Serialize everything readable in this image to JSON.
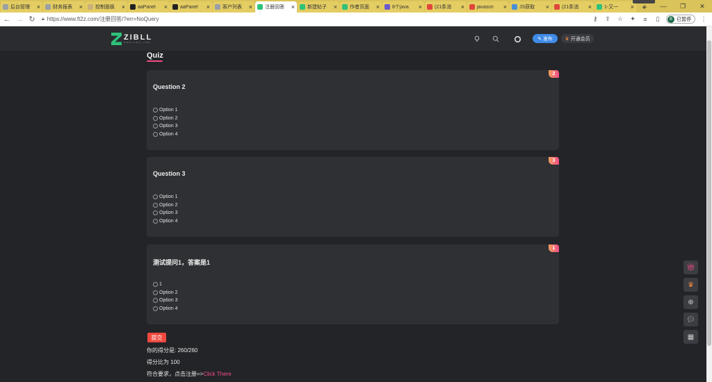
{
  "browser": {
    "tabs": [
      {
        "title": "后台管理",
        "color": "#9aa0a6"
      },
      {
        "title": "财务报表",
        "color": "#9aa0a6"
      },
      {
        "title": "控制面板",
        "color": "#c9b07a"
      },
      {
        "title": "aaPanel",
        "color": "#222222"
      },
      {
        "title": "aaPanel",
        "color": "#222222"
      },
      {
        "title": "客户列表",
        "color": "#9aa0a6"
      },
      {
        "title": "注册回答",
        "color": "#2ec27a"
      },
      {
        "title": "新建帖子",
        "color": "#2ec27a"
      },
      {
        "title": "作者页面",
        "color": "#2ec27a"
      },
      {
        "title": "8个java",
        "color": "#6a5acd"
      },
      {
        "title": "(21条消",
        "color": "#e0463c"
      },
      {
        "title": "javascri",
        "color": "#e0463c"
      },
      {
        "title": "JS获取",
        "color": "#4a90d9"
      },
      {
        "title": "(21条消",
        "color": "#e0463c"
      },
      {
        "title": "1-又一",
        "color": "#2ec27a"
      }
    ],
    "active_tab": 6,
    "new_tab": "+",
    "url": "https://www.ft2z.com/注册回答/?err=NoQuery",
    "profile_initial": "B",
    "profile_label": "已暂停"
  },
  "site": {
    "logo_text": "ZIBLL",
    "logo_sub": "WWW.ZIBLL.COM",
    "publish_label": "发布",
    "vip_label": "开通会员"
  },
  "quiz": {
    "title": "Quiz",
    "questions": [
      {
        "badge": "2",
        "title": "Question 2",
        "options": [
          "Option 1",
          "Option 2",
          "Option 3",
          "Option 4"
        ]
      },
      {
        "badge": "3",
        "title": "Question 3",
        "options": [
          "Option 1",
          "Option 2",
          "Option 3",
          "Option 4"
        ]
      },
      {
        "badge": "1",
        "title": "测试提问1，答案是1",
        "options": [
          "1",
          "Option 2",
          "Option 3",
          "Option 4"
        ]
      }
    ],
    "submit_label": "提交",
    "score_text": "你的得分是: 260/260",
    "ratio_text": "得分比为 100",
    "qualify_text": "符合要求，点击注册=>",
    "qualify_link": "Click There"
  },
  "icons": {
    "back": "arrow-left-icon",
    "forward": "arrow-right-icon",
    "reload": "reload-icon",
    "lightbulb": "lightbulb-icon",
    "search": "search-icon",
    "theme": "theme-toggle-icon",
    "float": [
      "gift-icon",
      "crown-icon",
      "plus-circle-icon",
      "wechat-icon",
      "qrcode-icon"
    ]
  }
}
